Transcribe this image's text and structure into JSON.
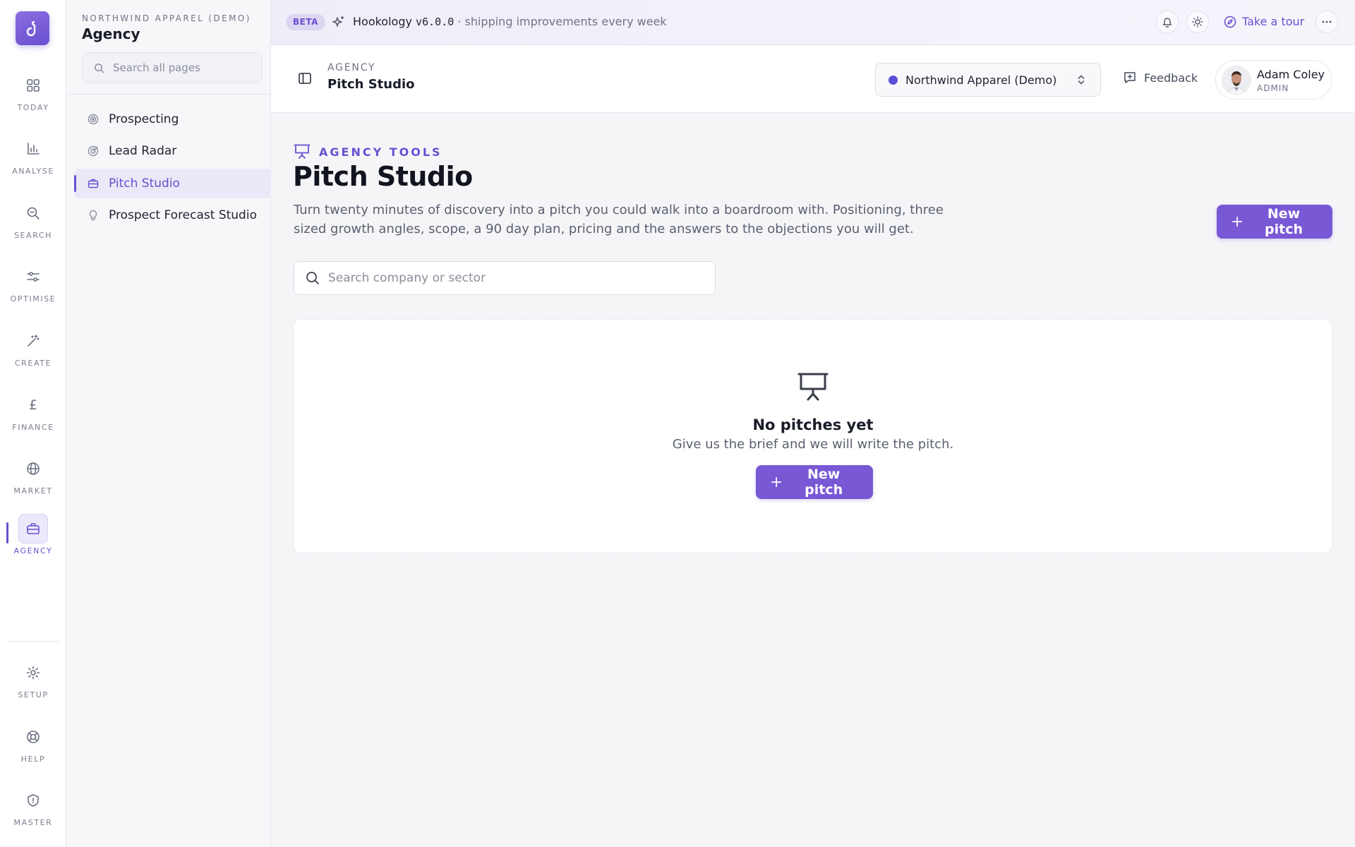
{
  "brand": {
    "logo_char": "d",
    "accent": "#6a4fd0"
  },
  "rail": {
    "items": [
      {
        "id": "today",
        "label": "TODAY",
        "icon": "grid-icon"
      },
      {
        "id": "analyse",
        "label": "ANALYSE",
        "icon": "bar-chart-icon"
      },
      {
        "id": "search",
        "label": "SEARCH",
        "icon": "search-zoom-icon"
      },
      {
        "id": "optimise",
        "label": "OPTIMISE",
        "icon": "sliders-icon"
      },
      {
        "id": "create",
        "label": "CREATE",
        "icon": "magic-wand-icon"
      },
      {
        "id": "finance",
        "label": "FINANCE",
        "icon": "pound-icon"
      },
      {
        "id": "market",
        "label": "MARKET",
        "icon": "globe-icon"
      },
      {
        "id": "agency",
        "label": "AGENCY",
        "icon": "briefcase-icon",
        "active": true
      }
    ],
    "bottom": [
      {
        "id": "setup",
        "label": "SETUP",
        "icon": "gear-icon"
      },
      {
        "id": "help",
        "label": "HELP",
        "icon": "lifebuoy-icon"
      },
      {
        "id": "master",
        "label": "MASTER",
        "icon": "shield-icon"
      }
    ]
  },
  "sidebar": {
    "org": "NORTHWIND APPAREL (DEMO)",
    "section": "Agency",
    "search_placeholder": "Search all pages",
    "items": [
      {
        "label": "Prospecting",
        "icon": "target-icon"
      },
      {
        "label": "Lead Radar",
        "icon": "radar-icon"
      },
      {
        "label": "Pitch Studio",
        "icon": "briefcase-icon",
        "active": true
      },
      {
        "label": "Prospect Forecast Studio",
        "icon": "lightbulb-icon"
      }
    ]
  },
  "topbar": {
    "beta": "BETA",
    "product": "Hookology",
    "version": "v6.0.0",
    "tagline": "· shipping improvements every week",
    "tour": "Take a tour"
  },
  "header": {
    "breadcrumb": "AGENCY",
    "title": "Pitch Studio",
    "org_selector": "Northwind Apparel (Demo)",
    "feedback": "Feedback",
    "user": {
      "name": "Adam Coley",
      "role": "ADMIN"
    }
  },
  "main": {
    "eyebrow": "AGENCY TOOLS",
    "title": "Pitch Studio",
    "description": "Turn twenty minutes of discovery into a pitch you could walk into a boardroom with. Positioning, three sized growth angles, scope, a 90 day plan, pricing and the answers to the objections you will get.",
    "new_pitch": "New pitch",
    "search_placeholder": "Search company or sector",
    "empty": {
      "title": "No pitches yet",
      "description": "Give us the brief and we will write the pitch.",
      "button": "New pitch"
    }
  }
}
